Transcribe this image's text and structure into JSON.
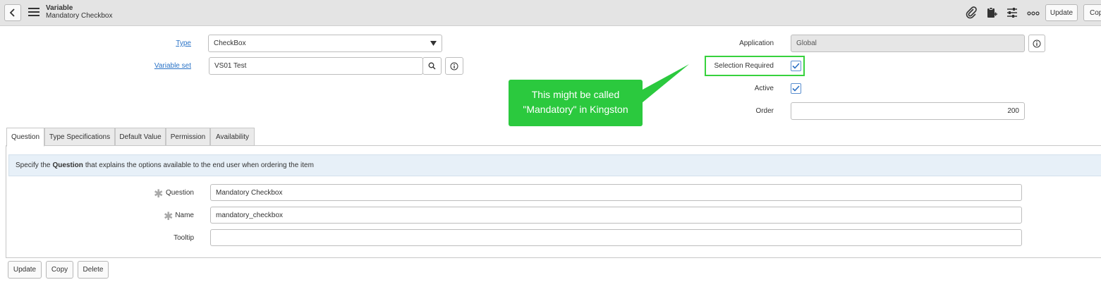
{
  "header": {
    "record_type": "Variable",
    "record_name": "Mandatory Checkbox",
    "update_label": "Update",
    "copy_label": "Cop",
    "icons": [
      "paperclip-icon",
      "clipboard-icon",
      "sliders-icon",
      "more-icon"
    ]
  },
  "form": {
    "type": {
      "label": "Type",
      "value": "CheckBox"
    },
    "variable_set": {
      "label": "Variable set",
      "value": "VS01 Test"
    },
    "application": {
      "label": "Application",
      "value": "Global"
    },
    "selection_required": {
      "label": "Selection Required",
      "checked": true
    },
    "active": {
      "label": "Active",
      "checked": true
    },
    "order": {
      "label": "Order",
      "value": "200"
    }
  },
  "callout": {
    "line1": "This might be called",
    "line2": "\"Mandatory\" in Kingston",
    "color": "#2bc93e"
  },
  "tabs": [
    {
      "label": "Question",
      "active": true
    },
    {
      "label": "Type Specifications",
      "active": false
    },
    {
      "label": "Default Value",
      "active": false
    },
    {
      "label": "Permission",
      "active": false
    },
    {
      "label": "Availability",
      "active": false
    }
  ],
  "question_tab": {
    "info_prefix": "Specify the",
    "info_bold": "Question",
    "info_suffix": "that explains the options available to the end user when ordering the item",
    "question": {
      "label": "Question",
      "value": "Mandatory Checkbox",
      "required": true
    },
    "name": {
      "label": "Name",
      "value": "mandatory_checkbox",
      "required": true
    },
    "tooltip": {
      "label": "Tooltip",
      "value": ""
    }
  },
  "footer": {
    "update_label": "Update",
    "copy_label": "Copy",
    "delete_label": "Delete"
  }
}
